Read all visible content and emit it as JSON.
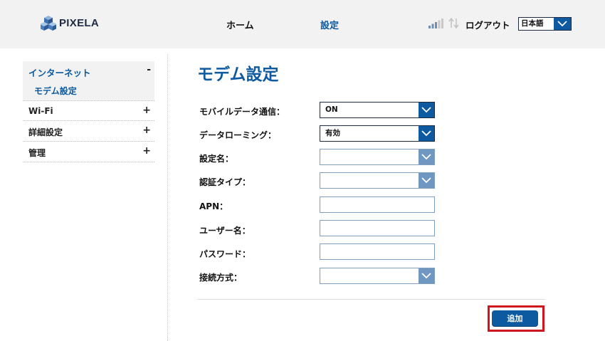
{
  "header": {
    "logo_text": "PIXELA",
    "nav": {
      "home": "ホーム",
      "settings": "設定"
    },
    "logout": "ログアウト",
    "language": {
      "selected": "日本語"
    },
    "signal_icon": "signal-bars-icon",
    "transfer_icon": "up-down-arrows-icon"
  },
  "sidebar": {
    "items": [
      {
        "label": "インターネット",
        "toggle": "-",
        "expanded": true,
        "children": [
          {
            "label": "モデム設定"
          }
        ]
      },
      {
        "label": "Wi-Fi",
        "toggle": "+"
      },
      {
        "label": "詳細設定",
        "toggle": "+"
      },
      {
        "label": "管理",
        "toggle": "+"
      }
    ]
  },
  "main": {
    "title": "モデム設定",
    "fields": [
      {
        "label": "モバイルデータ通信：",
        "type": "select",
        "value": "ON"
      },
      {
        "label": "データローミング：",
        "type": "select",
        "value": "有効"
      },
      {
        "label": "設定名：",
        "type": "select",
        "value": ""
      },
      {
        "label": "認証タイプ：",
        "type": "select",
        "value": ""
      },
      {
        "label": "APN：",
        "type": "text",
        "value": ""
      },
      {
        "label": "ユーザー名：",
        "type": "text",
        "value": ""
      },
      {
        "label": "パスワード：",
        "type": "text",
        "value": ""
      },
      {
        "label": "接続方式：",
        "type": "select",
        "value": ""
      }
    ],
    "add_button": "追加"
  },
  "colors": {
    "accent": "#0d5aa0",
    "header_bg": "#f2f2f2",
    "highlight_frame": "#d0161d"
  }
}
